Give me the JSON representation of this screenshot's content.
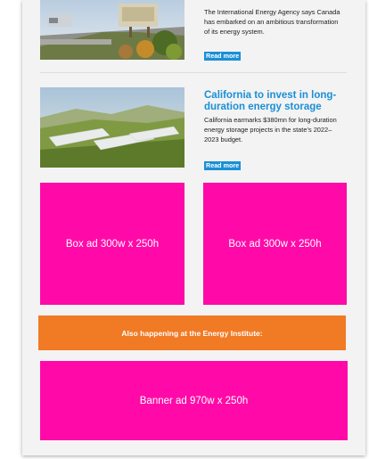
{
  "articles": [
    {
      "title": "",
      "description": "The International Energy Agency says Canada has embarked on an ambitious transformation of its energy system.",
      "read_more": "Read more",
      "image_icon": "highway-landscape-image"
    },
    {
      "title": "California to invest in long-duration energy storage",
      "description": "California earmarks $380mn for long-duration energy storage projects in the state’s 2022–2023 budget.",
      "read_more": "Read more",
      "image_icon": "battery-storage-field-image"
    }
  ],
  "ads": {
    "box_left": "Box ad 300w x 250h",
    "box_right": "Box ad 300w x 250h",
    "banner": "Banner ad 970w x 250h"
  },
  "happening": {
    "label": "Also happening at the Energy Institute:"
  },
  "colors": {
    "accent_blue": "#1a8fd6",
    "ad_magenta": "#ff0aa8",
    "banner_orange": "#f17a24",
    "sheet_bg": "#f3f3f3"
  }
}
